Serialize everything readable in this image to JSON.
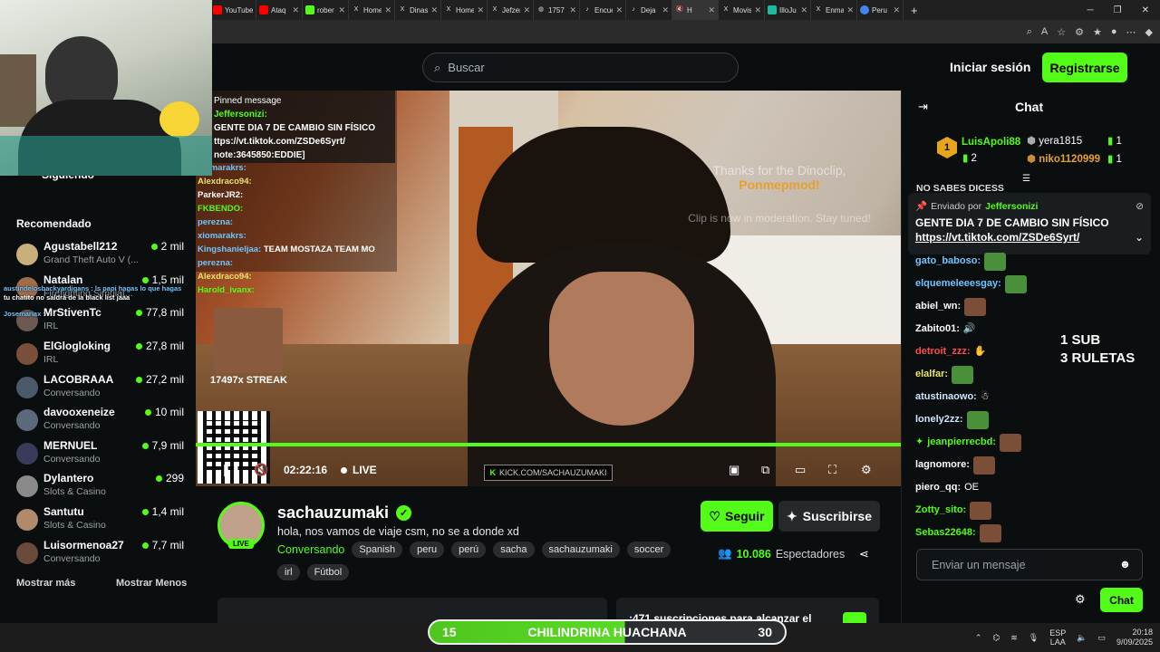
{
  "browser": {
    "tabs": [
      {
        "label": "YouTube",
        "color": "#ff0000"
      },
      {
        "label": "Ataq",
        "color": "#ff0000"
      },
      {
        "label": "rober",
        "color": "#53fc18"
      },
      {
        "label": "Home",
        "color": "#888888"
      },
      {
        "label": "Dinas",
        "color": "#888888"
      },
      {
        "label": "Home",
        "color": "#888888"
      },
      {
        "label": "Jefzer",
        "color": "#888888"
      },
      {
        "label": "1757",
        "color": "#888888"
      },
      {
        "label": "Encue",
        "color": "#888888"
      },
      {
        "label": "Deja",
        "color": "#888888"
      },
      {
        "label": "H",
        "color": "#888888"
      },
      {
        "label": "Movis",
        "color": "#888888"
      },
      {
        "label": "IlloJu",
        "color": "#1fb8a0"
      },
      {
        "label": "Enma",
        "color": "#888888"
      },
      {
        "label": "Peru",
        "color": "#4285f4"
      }
    ],
    "new_tab": "+"
  },
  "header": {
    "search_placeholder": "Buscar",
    "login": "Iniciar sesión",
    "register": "Registrarse"
  },
  "sidebar": {
    "following": "Siguiendo",
    "recommended_title": "Recomendado",
    "items": [
      {
        "name": "Agustabell212",
        "category": "Grand Theft Auto V (...",
        "viewers": "2 mil"
      },
      {
        "name": "Natalan",
        "category": "Firefighting Simulat...",
        "viewers": "1,5 mil"
      },
      {
        "name": "MrStivenTc",
        "category": "IRL",
        "viewers": "77,8 mil"
      },
      {
        "name": "ElGlogloking",
        "category": "IRL",
        "viewers": "27,8 mil"
      },
      {
        "name": "LACOBRAAA",
        "category": "Conversando",
        "viewers": "27,2 mil"
      },
      {
        "name": "davooxeneize",
        "category": "Conversando",
        "viewers": "10 mil"
      },
      {
        "name": "MERNUEL",
        "category": "Conversando",
        "viewers": "7,9 mil"
      },
      {
        "name": "Dylantero",
        "category": "Slots & Casino",
        "viewers": "299"
      },
      {
        "name": "Santutu",
        "category": "Slots & Casino",
        "viewers": "1,4 mil"
      },
      {
        "name": "Luisormenoa27",
        "category": "Conversando",
        "viewers": "7,7 mil"
      }
    ],
    "show_more": "Mostrar más",
    "show_less": "Mostrar Menos"
  },
  "video_overlay": {
    "pinned_header": "Pinned message",
    "pinned_user": "Jeffersonizi:",
    "pinned_line1": "GENTE DIA 7 DE CAMBIO SIN FÍSICO",
    "pinned_line2": "ttps://vt.tiktok.com/ZSDe6Syrt/",
    "pinned_line3": "note:3645850:EDDIE]",
    "overlay_chat": [
      {
        "user": "xiomarakrs:",
        "text": ""
      },
      {
        "user": "Alexdraco94:",
        "text": ""
      },
      {
        "user": "ParkerJR2:",
        "text": ""
      },
      {
        "user": "FKBENDO:",
        "text": ""
      },
      {
        "user": "perezna:",
        "text": ""
      },
      {
        "user": "xiomarakrs:",
        "text": ""
      },
      {
        "user": "Kingshanieljaa:",
        "text": "TEAM MOSTAZA TEAM MO"
      },
      {
        "user": "perezna:",
        "text": ""
      },
      {
        "user": "Alexdraco94:",
        "text": ""
      },
      {
        "user": "Harold_ivanx:",
        "text": ""
      }
    ],
    "overlay_side_msgs": [
      "austindelosbackyardigans : ls papi hagas lo que hagas",
      "tu chatito no saldrá de la black list jaaa",
      "Josemariax :"
    ],
    "streak": "17497x STREAK",
    "clip_thanks": "Thanks for the Dinoclip,",
    "clip_user": "Ponmepmod!",
    "clip_status": "Clip is now in moderation. Stay tuned!",
    "kick_tag": "KICK.COM/SACHAUZUMAKI"
  },
  "player": {
    "time": "02:22:16",
    "live_label": "LIVE",
    "progress": 1.0
  },
  "stream": {
    "name": "sachauzumaki",
    "live_badge": "LIVE",
    "title": "hola, nos vamos de viaje csm, no se a donde xd",
    "category": "Conversando",
    "tags": [
      "Spanish",
      "peru",
      "perú",
      "sacha",
      "sachauzumaki",
      "soccer"
    ],
    "tags2": [
      "irl",
      "Fútbol"
    ],
    "follow": "Seguir",
    "subscribe": "Suscribirse",
    "viewers_count": "10.086",
    "viewers_label": "Espectadores",
    "subs_goal_text": ":471 suscripciones para alcanzar el"
  },
  "chat": {
    "title": "Chat",
    "leaderboard": [
      {
        "rank": "1",
        "user": "LuisApoli88",
        "count": "2"
      },
      {
        "rank": "",
        "user": "yera1815",
        "count": "1"
      },
      {
        "rank": "",
        "user": "niko1120999",
        "count": "1"
      }
    ],
    "prev_msg": "NO SABES DICESS",
    "pinned_by_label": "Enviado por",
    "pinned_by_user": "Jeffersonizi",
    "pinned_text": "GENTE DIA 7 DE CAMBIO SIN FÍSICO",
    "pinned_link": "https://vt.tiktok.com/ZSDe6Syrt/",
    "messages": [
      {
        "user": "gato_baboso:",
        "text": "",
        "color": "#6fc5ff"
      },
      {
        "user": "elquemeleeesgay:",
        "text": "",
        "color": "#6fc5ff"
      },
      {
        "user": "abiel_wn:",
        "text": "",
        "color": "#ffffff"
      },
      {
        "user": "Zabito01:",
        "text": "",
        "color": "#ffffff"
      },
      {
        "user": "detroit_zzz:",
        "text": "",
        "color": "#ff4d4d"
      },
      {
        "user": "elalfar:",
        "text": "",
        "color": "#e8e36a"
      },
      {
        "user": "atustinaowo:",
        "text": "",
        "color": "#cfe3ff"
      },
      {
        "user": "lonely2zz:",
        "text": "",
        "color": "#cfe3ff"
      },
      {
        "user": "jeanpierrecbd:",
        "text": "",
        "color": "#53fc18"
      },
      {
        "user": "lagnomore:",
        "text": "",
        "color": "#ffffff"
      },
      {
        "user": "piero_qq:",
        "text": "OE",
        "color": "#ffffff"
      },
      {
        "user": "Zotty_sito:",
        "text": "",
        "color": "#53fc18"
      },
      {
        "user": "Sebas22648:",
        "text": "",
        "color": "#53fc18"
      }
    ],
    "sub_sign_line1": "1 SUB",
    "sub_sign_line2": "3 RULETAS",
    "input_placeholder": "Enviar un mensaje",
    "send": "Chat"
  },
  "banner": {
    "left": "15",
    "title": "CHILINDRINA HUACHANA",
    "right": "30"
  },
  "taskbar": {
    "lang1": "ESP",
    "lang2": "LAA",
    "time": "20:18",
    "date": "9/09/2025"
  },
  "colors": {
    "brand": "#53fc18",
    "bg": "#0b0e0f"
  }
}
